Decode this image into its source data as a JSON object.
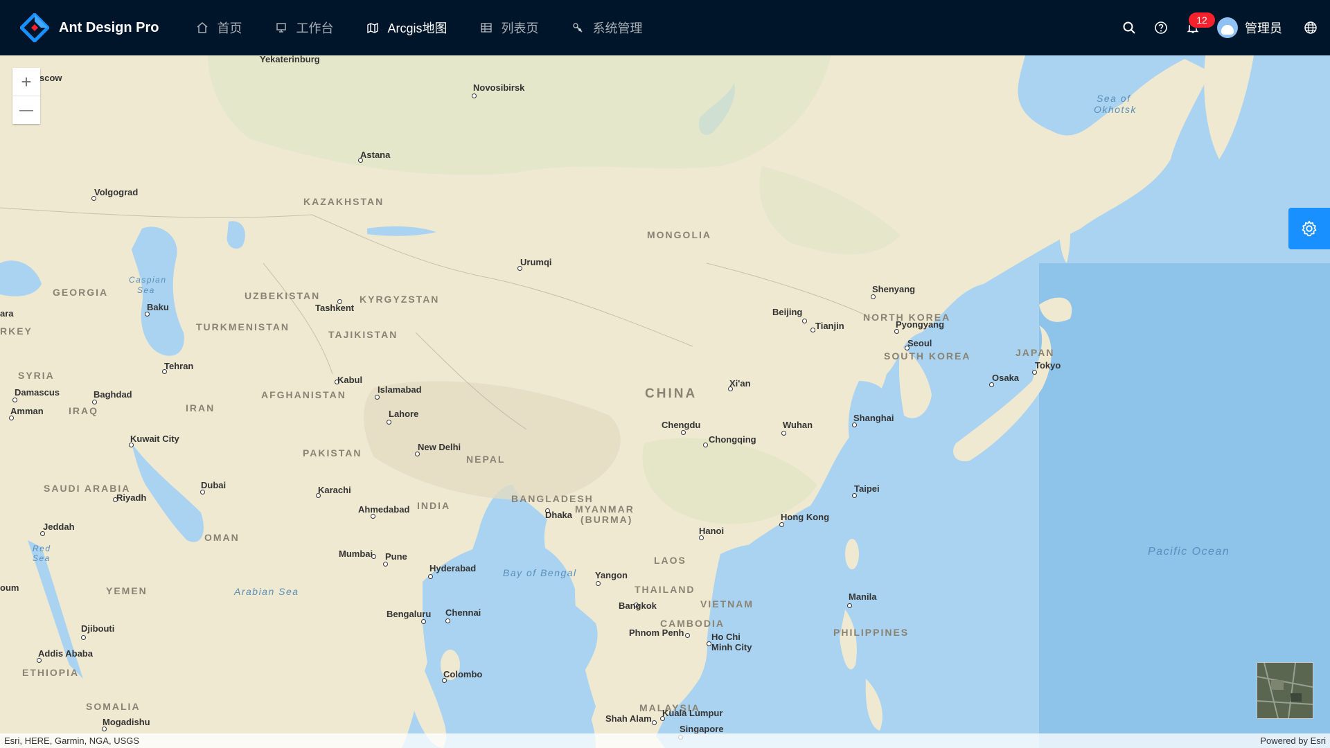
{
  "brand": {
    "title": "Ant Design Pro"
  },
  "nav": {
    "items": [
      {
        "label": "首页",
        "icon": "home-icon"
      },
      {
        "label": "工作台",
        "icon": "desktop-icon"
      },
      {
        "label": "Arcgis地图",
        "icon": "map-icon",
        "active": true
      },
      {
        "label": "列表页",
        "icon": "table-icon"
      },
      {
        "label": "系统管理",
        "icon": "setting-tool-icon"
      }
    ]
  },
  "header": {
    "notification_count": "12",
    "username": "管理员"
  },
  "map": {
    "labels": {
      "yekaterinburg": "Yekaterinburg",
      "moscow": "scow",
      "novosibirsk": "Novosibirsk",
      "astana": "Astana",
      "volgograd": "Volgograd",
      "kazakhstan": "KAZAKHSTAN",
      "mongolia": "MONGOLIA",
      "sea_okhotsk_1": "Sea of",
      "sea_okhotsk_2": "Okhotsk",
      "caspian_1": "Caspian",
      "caspian_2": "Sea",
      "georgia": "GEORGIA",
      "baku": "Baku",
      "uzbekistan": "UZBEKISTAN",
      "kyrgyzstan": "KYRGYZSTAN",
      "tashkent": "Tashkent",
      "urumqi": "Urumqi",
      "shenyang": "Shenyang",
      "beijing": "Beijing",
      "tianjin": "Tianjin",
      "north_korea": "NORTH KOREA",
      "pyongyang": "Pyongyang",
      "seoul": "Seoul",
      "south_korea": "SOUTH KOREA",
      "japan": "JAPAN",
      "tokyo": "Tokyo",
      "osaka": "Osaka",
      "turkey": "RKEY",
      "ara": "ara",
      "turkmenistan": "TURKMENISTAN",
      "tajikistan": "TAJIKISTAN",
      "tehran": "Tehran",
      "syria": "SYRIA",
      "damascus": "Damascus",
      "baghdad": "Baghdad",
      "amman": "Amman",
      "iraq": "IRAQ",
      "iran": "IRAN",
      "kabul": "Kabul",
      "afghanistan": "AFGHANISTAN",
      "islamabad": "Islamabad",
      "lahore": "Lahore",
      "china": "CHINA",
      "xian": "Xi'an",
      "chengdu": "Chengdu",
      "chongqing": "Chongqing",
      "wuhan": "Wuhan",
      "shanghai": "Shanghai",
      "kuwait": "Kuwait City",
      "pakistan": "PAKISTAN",
      "new_delhi": "New Delhi",
      "nepal": "NEPAL",
      "saudi": "SAUDI ARABIA",
      "riyadh": "Riyadh",
      "dubai": "Dubai",
      "karachi": "Karachi",
      "bangladesh": "BANGLADESH",
      "myanmar_1": "MYANMAR",
      "myanmar_2": "(BURMA)",
      "dhaka": "Dhaka",
      "taipei": "Taipei",
      "hong_kong": "Hong Kong",
      "ahmedabad": "Ahmedabad",
      "india": "INDIA",
      "jeddah": "Jeddah",
      "oman": "OMAN",
      "hanoi": "Hanoi",
      "red_sea_1": "Red",
      "red_sea_2": "Sea",
      "mumbai": "Mumbai",
      "pune": "Pune",
      "hyderabad": "Hyderabad",
      "laos": "LAOS",
      "pacific": "Pacific  Ocean",
      "bay_bengal": "Bay of Bengal",
      "yangon": "Yangon",
      "oum": "oum",
      "yemen": "YEMEN",
      "arabian_sea": "Arabian Sea",
      "thailand": "THAILAND",
      "manila": "Manila",
      "bangkok": "Bangkok",
      "vietnam": "VIETNAM",
      "bengaluru": "Bengaluru",
      "chennai": "Chennai",
      "cambodia": "CAMBODIA",
      "phnom_penh": "Phnom Penh",
      "hcmc_1": "Ho Chi",
      "hcmc_2": "Minh City",
      "philippines": "PHILIPPINES",
      "djibouti": "Djibouti",
      "addis": "Addis Ababa",
      "ethiopia": "ETHIOPIA",
      "colombo": "Colombo",
      "somalia": "SOMALIA",
      "malaysia": "MALAYSIA",
      "kuala": "Kuala Lumpur",
      "shah_alam": "Shah Alam",
      "mogadishu": "Mogadishu",
      "singapore": "Singapore"
    },
    "zoom_in_label": "+",
    "zoom_out_label": "—",
    "attribution_left": "Esri, HERE, Garmin, NGA, USGS",
    "attribution_right": "Powered by Esri"
  },
  "colors": {
    "header_bg": "#001529",
    "accent": "#1890ff",
    "badge": "#f5222d",
    "land": "#efe9d2",
    "ocean": "#a9d3f0"
  }
}
